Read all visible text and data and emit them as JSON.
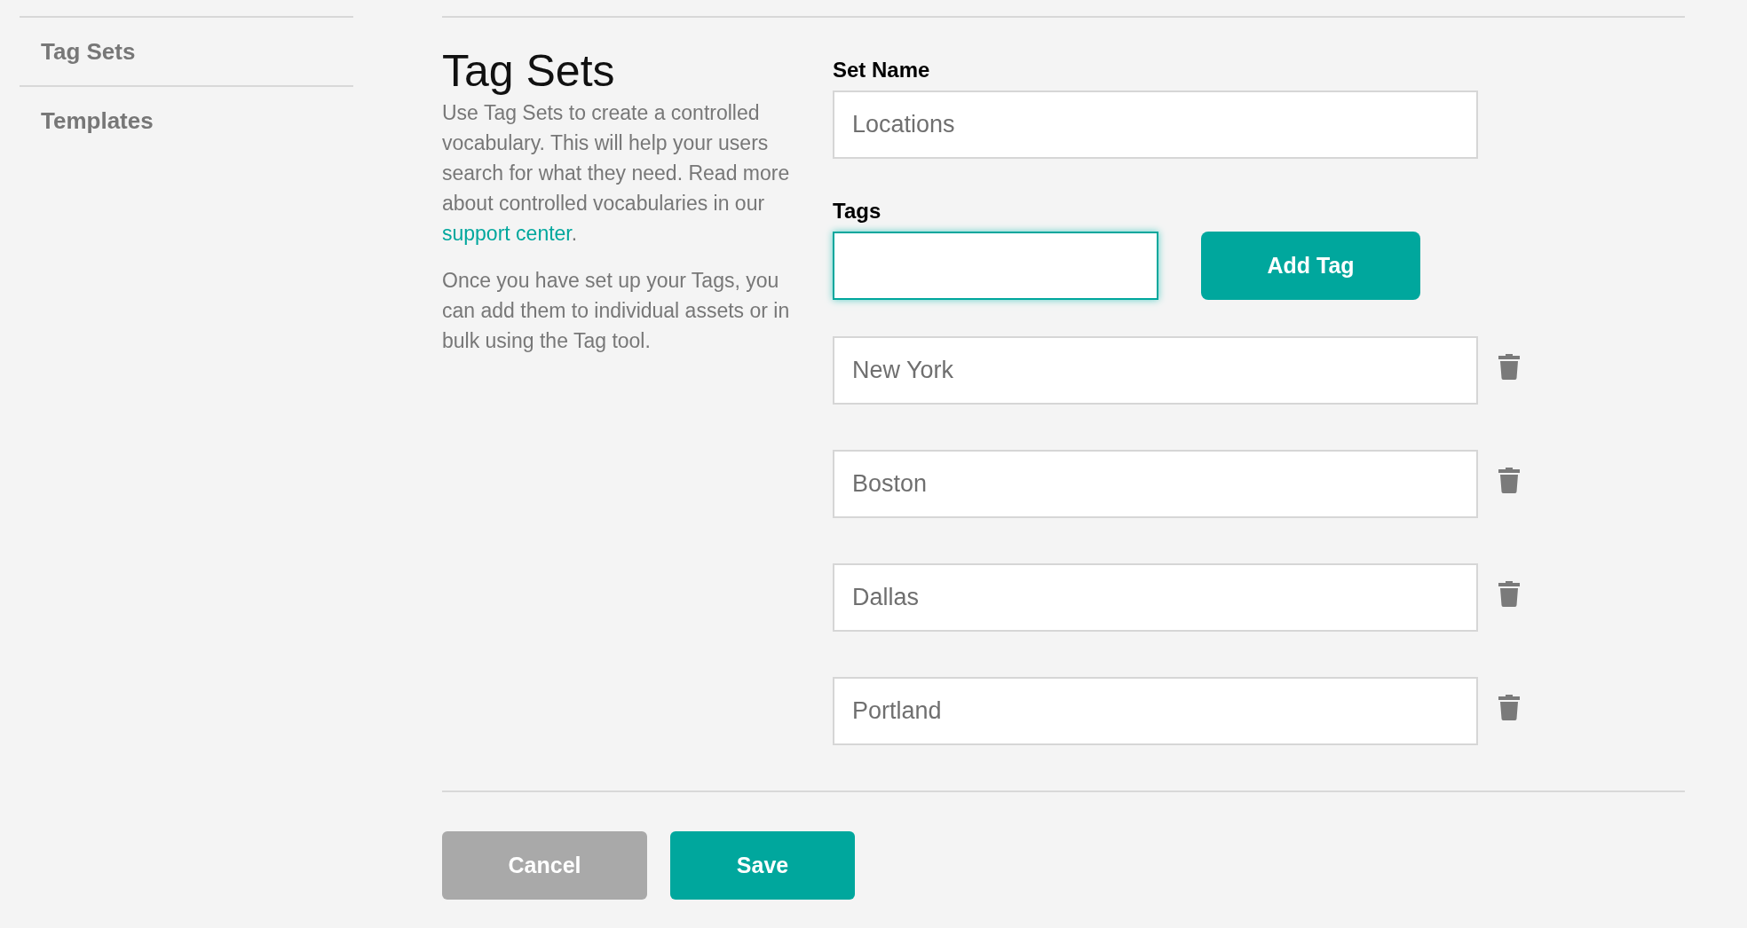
{
  "sidebar": {
    "items": [
      {
        "label": "Tag Sets"
      },
      {
        "label": "Templates"
      }
    ]
  },
  "intro": {
    "title": "Tag Sets",
    "paragraph_1": {
      "before": "Use Tag Sets to create a controlled vocabulary. This will help your users search for what they need. Read more about controlled vocabularies in our ",
      "link": "support center",
      "after": "."
    },
    "paragraph_2": "Once you have set up your Tags, you can add them to individual assets or in bulk using the Tag tool."
  },
  "form": {
    "set_name_label": "Set Name",
    "set_name_value": "Locations",
    "tags_label": "Tags",
    "new_tag": {
      "focused": true
    },
    "add_button": "Add Tag",
    "tags": [
      {
        "value": "New York"
      },
      {
        "value": "Boston"
      },
      {
        "value": "Dallas"
      },
      {
        "value": "Portland"
      }
    ]
  },
  "buttons": {
    "cancel": "Cancel",
    "save": "Save"
  }
}
